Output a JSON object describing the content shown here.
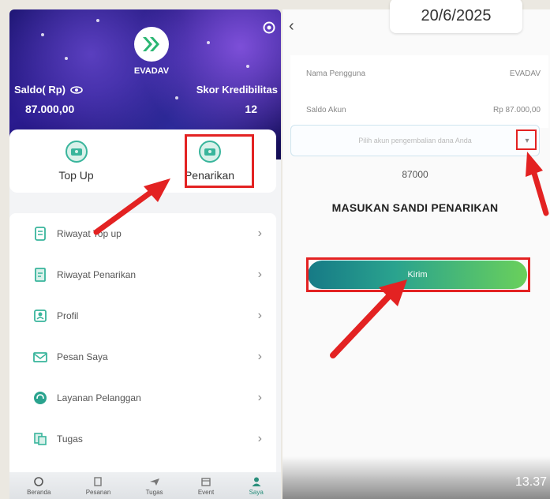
{
  "left": {
    "brand": "EVADAV",
    "saldo_label": "Saldo( Rp)",
    "saldo_value": "87.000,00",
    "skor_label": "Skor Kredibilitas",
    "skor_value": "12",
    "actions": [
      {
        "label": "Top Up",
        "icon": "money-icon"
      },
      {
        "label": "Penarikan",
        "icon": "money-icon"
      }
    ],
    "menu": [
      {
        "label": "Riwayat Top up",
        "icon": "receipt-icon"
      },
      {
        "label": "Riwayat Penarikan",
        "icon": "document-icon"
      },
      {
        "label": "Profil",
        "icon": "profile-card-icon"
      },
      {
        "label": "Pesan Saya",
        "icon": "mail-icon"
      },
      {
        "label": "Layanan Pelanggan",
        "icon": "headset-icon"
      },
      {
        "label": "Tugas",
        "icon": "task-icon"
      }
    ],
    "nav": [
      {
        "label": "Beranda",
        "icon": "home-icon"
      },
      {
        "label": "Pesanan",
        "icon": "orders-icon"
      },
      {
        "label": "Tugas",
        "icon": "plane-icon"
      },
      {
        "label": "Event",
        "icon": "event-icon"
      },
      {
        "label": "Saya",
        "icon": "user-icon"
      }
    ]
  },
  "right": {
    "date": "20/6/2025",
    "username_label": "Nama Pengguna",
    "username_value": "EVADAV",
    "balance_label": "Saldo Akun",
    "balance_value": "Rp 87.000,00",
    "select_placeholder": "Pilih akun pengembalian dana Anda",
    "amount": "87000",
    "pin_title": "MASUKAN SANDI PENARIKAN",
    "submit_label": "Kirim",
    "time": "13.37"
  },
  "colors": {
    "accent": "#39b59c",
    "highlight": "#e32222",
    "hero_dark": "#1b1470"
  }
}
